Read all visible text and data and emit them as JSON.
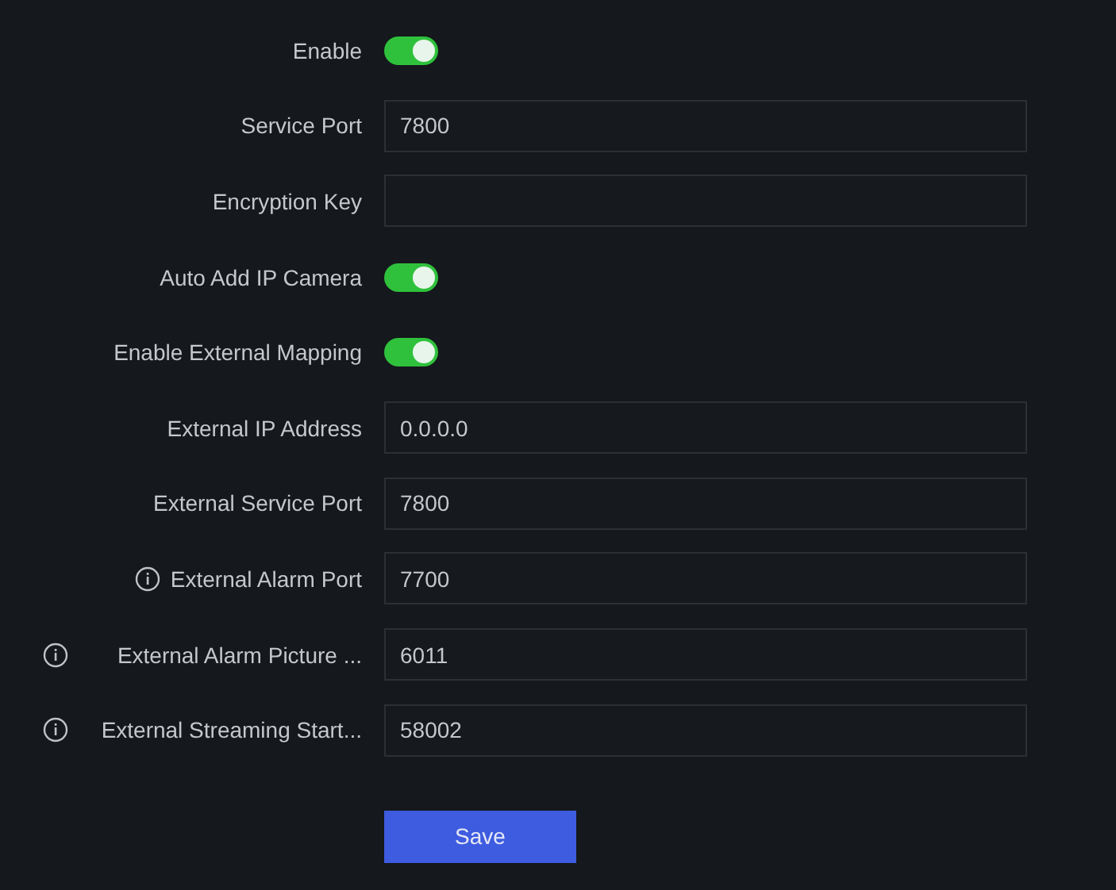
{
  "rows": [
    {
      "kind": "toggle",
      "label": "Enable",
      "on": true
    },
    {
      "kind": "field",
      "label": "Service Port",
      "value": "7800"
    },
    {
      "kind": "field",
      "label": "Encryption Key"
    },
    {
      "kind": "toggle",
      "label": "Auto Add IP Camera",
      "on": true
    },
    {
      "kind": "toggle",
      "label": "Enable External Mapping",
      "on": true
    },
    {
      "kind": "field",
      "label": "External IP Address",
      "value": "0.0.0.0"
    },
    {
      "kind": "field",
      "label": "External Service Port",
      "value": "7800"
    },
    {
      "kind": "field",
      "label": "External Alarm Port",
      "value": "7700",
      "info": true
    },
    {
      "kind": "field",
      "label": "External Alarm Picture ...",
      "value": "6011",
      "info": true
    },
    {
      "kind": "field",
      "label": "External Streaming Start...",
      "value": "58002",
      "info": true
    }
  ],
  "save_button": "Save"
}
